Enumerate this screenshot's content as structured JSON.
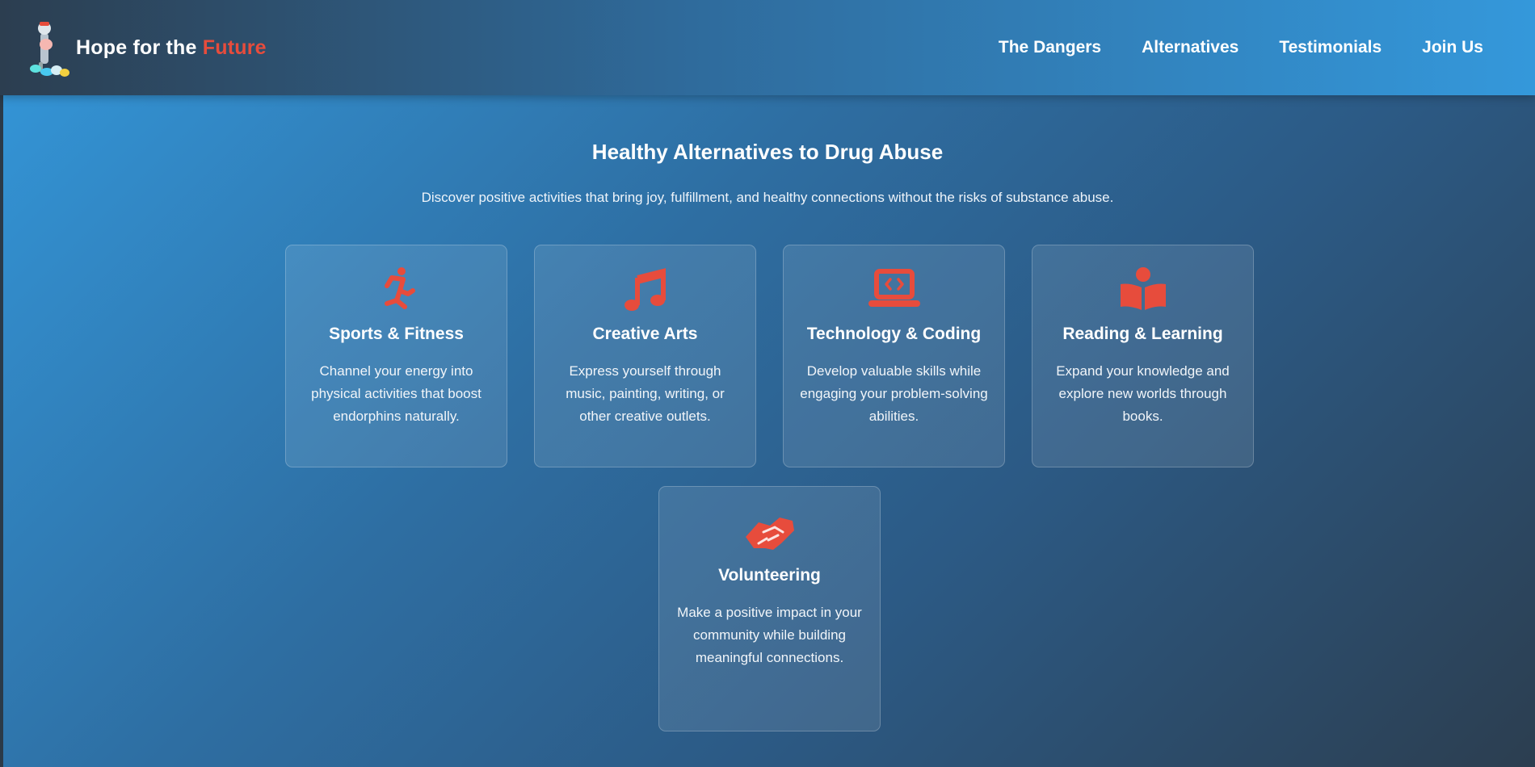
{
  "header": {
    "logo_text_main": "Hope for the ",
    "logo_text_accent": "Future",
    "nav": [
      "The Dangers",
      "Alternatives",
      "Testimonials",
      "Join Us"
    ]
  },
  "section": {
    "title": "Healthy Alternatives to Drug Abuse",
    "subtitle": "Discover positive activities that bring joy, fulfillment, and healthy connections without the risks of substance abuse."
  },
  "cards": [
    {
      "icon": "running-person-icon",
      "title": "Sports & Fitness",
      "text": "Channel your energy into physical activities that boost endorphins naturally."
    },
    {
      "icon": "music-note-icon",
      "title": "Creative Arts",
      "text": "Express yourself through music, painting, writing, or other creative outlets."
    },
    {
      "icon": "laptop-code-icon",
      "title": "Technology & Coding",
      "text": "Develop valuable skills while engaging your problem-solving abilities."
    },
    {
      "icon": "book-reader-icon",
      "title": "Reading & Learning",
      "text": "Expand your knowledge and explore new worlds through books."
    },
    {
      "icon": "handshake-icon",
      "title": "Volunteering",
      "text": "Make a positive impact in your community while building meaningful connections."
    }
  ],
  "colors": {
    "accent": "#e74c3c",
    "header_start": "#2c3e50",
    "header_end": "#3498db",
    "background_start": "#3498db",
    "background_end": "#2c3e50"
  }
}
